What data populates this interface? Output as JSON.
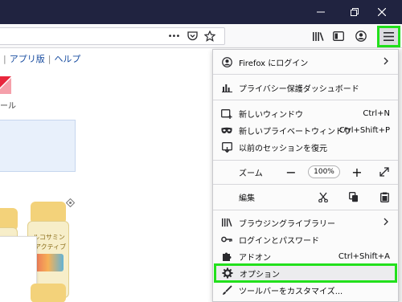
{
  "titlebar": {
    "minimize_icon": "minimize-icon",
    "maximize_icon": "restore-icon",
    "close_icon": "close-icon"
  },
  "navbar": {
    "page_actions": "•••",
    "pocket_icon": "pocket-icon",
    "bookmark_icon": "star-icon",
    "library_icon": "library-icon",
    "sidebar_icon": "sidebar-icon",
    "account_icon": "account-icon",
    "menu_icon": "hamburger-menu-icon"
  },
  "page": {
    "link_app": "アプリ版",
    "link_help": "ヘルプ",
    "logo_text": "ール",
    "bottle_label_1": "ルコサミン",
    "bottle_label_2": "アクティブ"
  },
  "menu": {
    "login": {
      "label": "Firefox にログイン",
      "icon": "account-icon"
    },
    "privacy": {
      "label": "プライバシー保護ダッシュボード",
      "icon": "dashboard-icon"
    },
    "new_window": {
      "label": "新しいウィンドウ",
      "shortcut": "Ctrl+N",
      "icon": "new-window-icon"
    },
    "private_window": {
      "label": "新しいプライベートウィンドウ",
      "shortcut": "Ctrl+Shift+P",
      "icon": "private-mask-icon"
    },
    "restore_session": {
      "label": "以前のセッションを復元",
      "icon": "restore-session-icon"
    },
    "zoom": {
      "label": "ズーム",
      "value": "100%",
      "minus": "−",
      "plus": "+"
    },
    "edit": {
      "label": "編集"
    },
    "library": {
      "label": "ブラウジングライブラリー",
      "icon": "library-icon"
    },
    "logins": {
      "label": "ログインとパスワード",
      "icon": "key-icon"
    },
    "addons": {
      "label": "アドオン",
      "shortcut": "Ctrl+Shift+A",
      "icon": "puzzle-icon"
    },
    "options": {
      "label": "オプション",
      "icon": "gear-icon"
    },
    "customize": {
      "label": "ツールバーをカスタマイズ...",
      "icon": "brush-icon"
    }
  },
  "colors": {
    "titlebar": "#202340",
    "highlight": "#22e01c"
  }
}
